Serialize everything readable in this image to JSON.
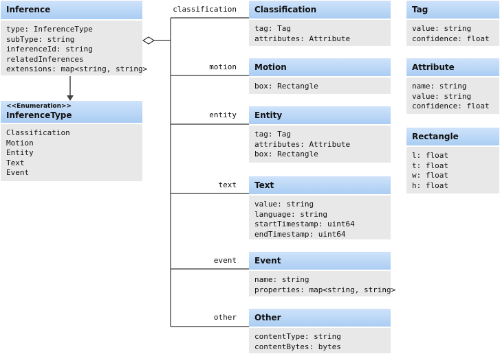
{
  "inference": {
    "title": "Inference",
    "fields": [
      "type: InferenceType",
      "subType: string",
      "inferenceId: string",
      "relatedInferences",
      "extensions: map<string, string>"
    ]
  },
  "inference_type": {
    "stereotype": "<<Enumeration>>",
    "title": "InferenceType",
    "values": [
      "Classification",
      "Motion",
      "Entity",
      "Text",
      "Event"
    ]
  },
  "relations": [
    "classification",
    "motion",
    "entity",
    "text",
    "event",
    "other"
  ],
  "classification": {
    "title": "Classification",
    "fields": [
      "tag: Tag",
      "attributes: Attribute"
    ]
  },
  "motion": {
    "title": "Motion",
    "fields": [
      "box: Rectangle"
    ]
  },
  "entity": {
    "title": "Entity",
    "fields": [
      "tag: Tag",
      "attributes: Attribute",
      "box: Rectangle"
    ]
  },
  "text": {
    "title": "Text",
    "fields": [
      "value: string",
      "language: string",
      "startTimestamp: uint64",
      "endTimestamp: uint64"
    ]
  },
  "event": {
    "title": "Event",
    "fields": [
      "name: string",
      "properties: map<string, string>"
    ]
  },
  "other": {
    "title": "Other",
    "fields": [
      "contentType: string",
      "contentBytes: bytes"
    ]
  },
  "tag": {
    "title": "Tag",
    "fields": [
      "value: string",
      "confidence: float"
    ]
  },
  "attribute": {
    "title": "Attribute",
    "fields": [
      "name: string",
      "value: string",
      "confidence: float"
    ]
  },
  "rectangle": {
    "title": "Rectangle",
    "fields": [
      "l: float",
      "t: float",
      "w: float",
      "h: float"
    ]
  }
}
